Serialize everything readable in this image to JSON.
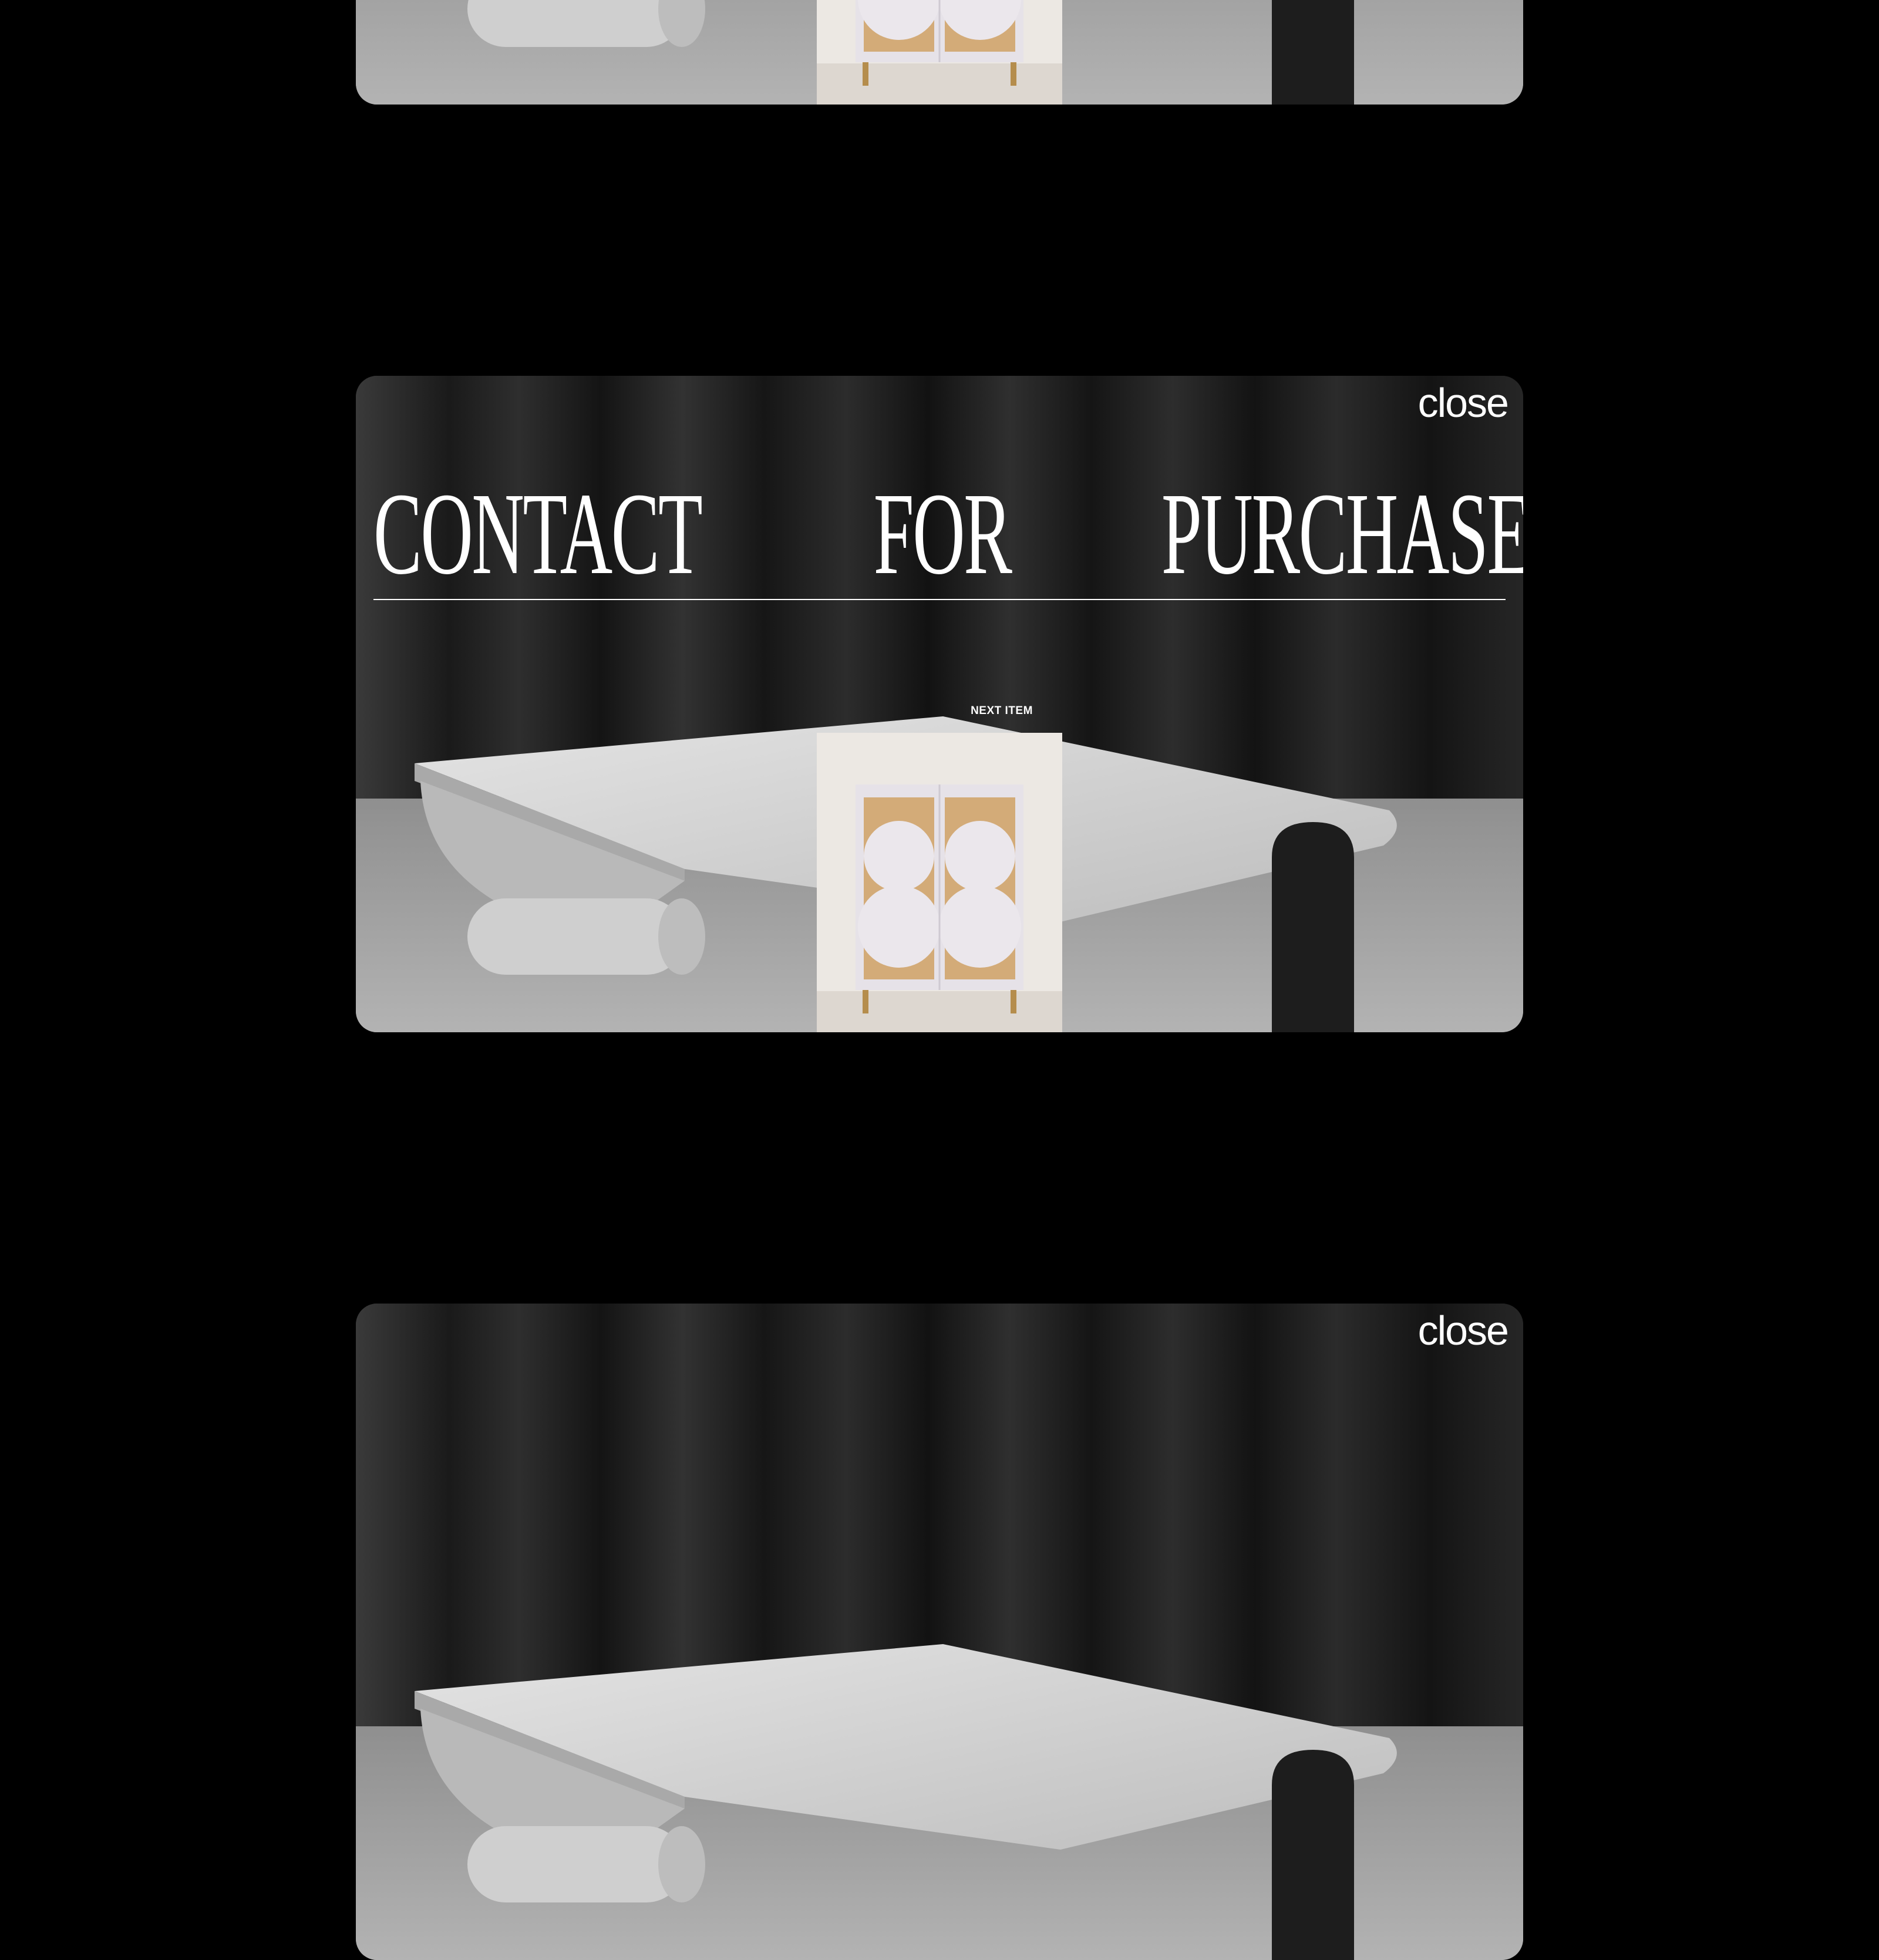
{
  "card": {
    "close_label": "close",
    "headline": [
      "CONTACT",
      "FOR",
      "PURCHASE"
    ],
    "next_label": "NEXT ITEM"
  },
  "colors": {
    "background": "#000000",
    "text": "#ffffff",
    "cane": "#d6ad78"
  },
  "icons": [
    "cabinet-image",
    "table-image"
  ]
}
